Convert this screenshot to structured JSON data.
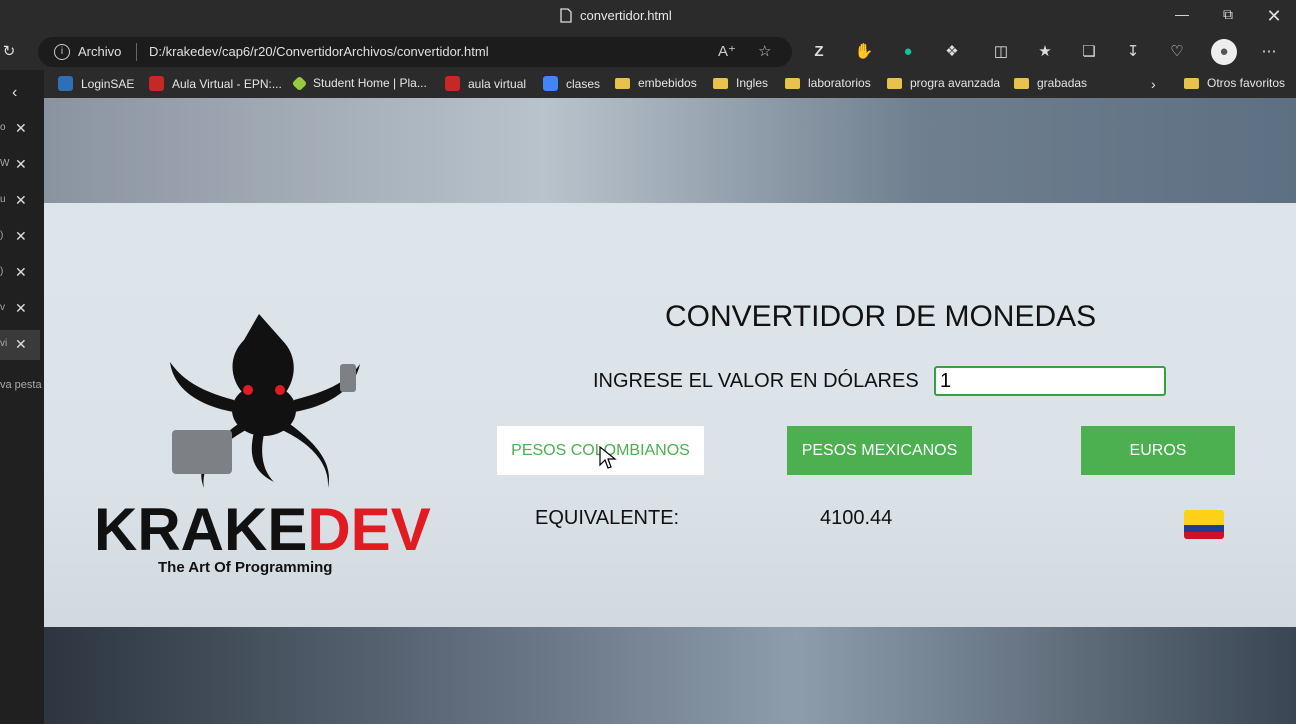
{
  "window": {
    "tab_title": "convertidor.html",
    "controls": [
      "minimize-icon",
      "restore-icon",
      "close-icon"
    ]
  },
  "address_bar": {
    "protocol_label": "Archivo",
    "url": "D:/krakedev/cap6/r20/ConvertidorArchivos/convertidor.html"
  },
  "bookmarks": [
    {
      "label": "LoginSAE",
      "icon": "loginsae-icon"
    },
    {
      "label": "Aula Virtual - EPN:...",
      "icon": "aula-icon"
    },
    {
      "label": "Student Home | Pla...",
      "icon": "platzi-icon"
    },
    {
      "label": "aula virtual",
      "icon": "aula-icon"
    },
    {
      "label": "clases",
      "icon": "calendar-icon"
    },
    {
      "label": "embebidos",
      "icon": "folder-icon"
    },
    {
      "label": "Ingles",
      "icon": "folder-icon"
    },
    {
      "label": "laboratorios",
      "icon": "folder-icon"
    },
    {
      "label": "progra avanzada",
      "icon": "folder-icon"
    },
    {
      "label": "grabadas",
      "icon": "folder-icon"
    },
    {
      "label": "Otros favoritos",
      "icon": "folder-icon"
    }
  ],
  "sidebar": {
    "new_tab_fragment": "va pesta",
    "tab_fragments": [
      "o",
      "W",
      "u",
      ")",
      ")",
      "v",
      "vi"
    ]
  },
  "app": {
    "logo_text": "KRAKEDEV",
    "logo_tagline": "The Art Of Programming",
    "title": "CONVERTIDOR DE MONEDAS",
    "input_label": "INGRESE EL VALOR EN DÓLARES",
    "input_value": "1",
    "buttons": [
      "PESOS COLOMBIANOS",
      "PESOS MEXICANOS",
      "EUROS"
    ],
    "active_button": "PESOS COLOMBIANOS",
    "result_label": "EQUIVALENTE:",
    "result_value": "4100.44",
    "flag": "colombia-flag-icon",
    "colors": {
      "button_green": "#4caf50",
      "logo_red": "#e01b22",
      "logo_black": "#111111"
    }
  }
}
